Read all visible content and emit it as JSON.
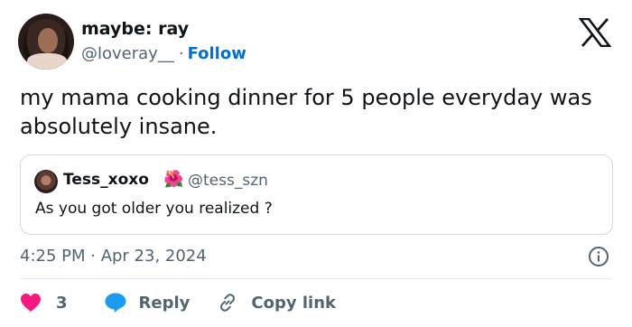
{
  "author": {
    "display_name": "maybe: ray",
    "handle": "@loveray__",
    "separator": "·",
    "follow_label": "Follow"
  },
  "tweet": {
    "text": "my mama cooking dinner for 5 people everyday was absolutely insane."
  },
  "quote": {
    "display_name": "Tess_xoxo",
    "emoji": "🌺",
    "handle": "@tess_szn",
    "text": "As you got older you realized ?"
  },
  "timestamp": "4:25 PM · Apr 23, 2024",
  "actions": {
    "like_count": "3",
    "reply_label": "Reply",
    "copy_label": "Copy link"
  },
  "colors": {
    "text": "#0f1419",
    "secondary": "#536471",
    "follow": "#006fd6",
    "heart": "#f91880",
    "reply_bubble": "#1d9bf0",
    "border": "#cfd9de"
  },
  "icons": [
    "x-logo-icon",
    "info-icon",
    "heart-icon",
    "reply-icon",
    "link-icon",
    "flower-icon"
  ]
}
